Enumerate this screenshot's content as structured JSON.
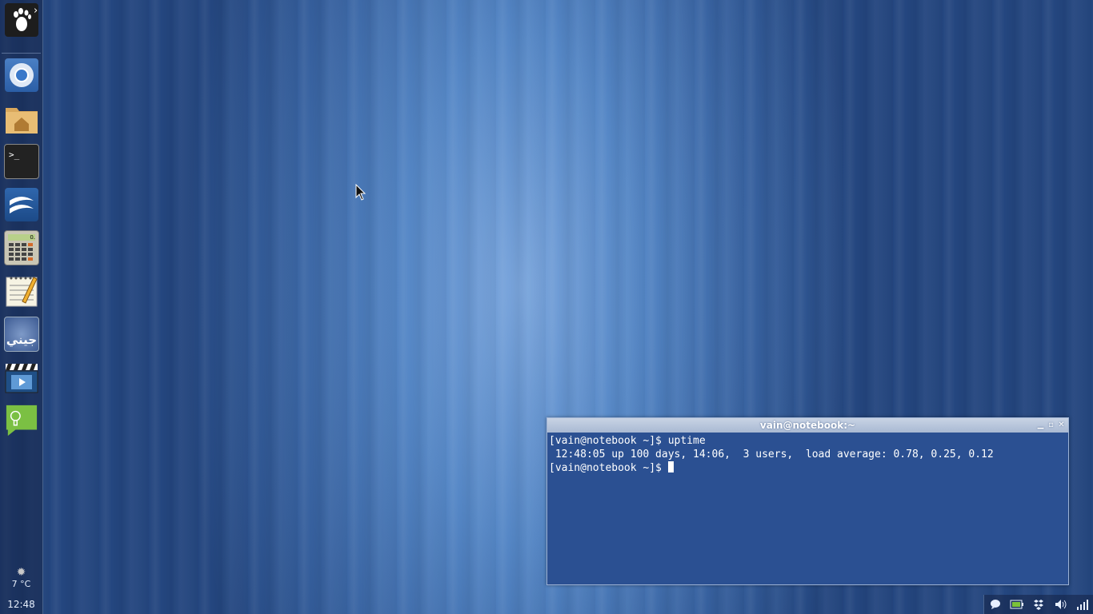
{
  "dock": {
    "menu_arrow": "›",
    "items": [
      {
        "name": "gnome-foot-icon"
      },
      {
        "name": "chromium-icon"
      },
      {
        "name": "home-folder-icon"
      },
      {
        "name": "terminal-icon"
      },
      {
        "name": "openoffice-icon"
      },
      {
        "name": "calculator-icon"
      },
      {
        "name": "text-editor-icon"
      },
      {
        "name": "arabic-app-icon"
      },
      {
        "name": "video-player-icon"
      },
      {
        "name": "chat-icon"
      }
    ],
    "terminal_prompt_glyph": ">_",
    "calculator_display": "0.",
    "arabic_label": "جيني",
    "weather": {
      "icon": "sun-icon",
      "temperature": "7 °C"
    },
    "clock": "12:48"
  },
  "terminal": {
    "title": "vain@notebook:~",
    "buttons": [
      "minimize",
      "maximize",
      "close"
    ],
    "lines": [
      "[vain@notebook ~]$ uptime",
      " 12:48:05 up 100 days, 14:06,  3 users,  load average: 0.78, 0.25, 0.12",
      "[vain@notebook ~]$ "
    ]
  },
  "tray": {
    "icons": [
      "chat-bubble-icon",
      "battery-icon",
      "dropbox-icon",
      "volume-icon",
      "signal-icon"
    ]
  },
  "colors": {
    "desktop_center": "#7ba6dd",
    "desktop_edge": "#24467f",
    "terminal_bg": "#2b5092",
    "terminal_title": "#b8c6dc"
  }
}
